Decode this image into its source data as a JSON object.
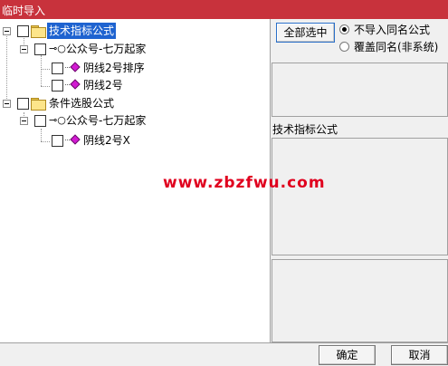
{
  "window": {
    "title": "临时导入"
  },
  "tree": {
    "nodes": [
      {
        "label": "技术指标公式"
      },
      {
        "label": "公众号-七万起家"
      },
      {
        "label": "阴线2号排序"
      },
      {
        "label": "阴线2号"
      },
      {
        "label": "条件选股公式"
      },
      {
        "label": "公众号-七万起家"
      },
      {
        "label": "阴线2号X"
      }
    ]
  },
  "options": {
    "select_all_label": "全部选中",
    "radio_no_import": "不导入同名公式",
    "radio_overwrite": "覆盖同名(非系统)"
  },
  "detail": {
    "title": "技术指标公式"
  },
  "watermark": "www.zbzfwu.com",
  "buttons": {
    "ok": "确定",
    "cancel": "取消"
  },
  "colors": {
    "titlebar": "#c8323c",
    "selection": "#1e63d0",
    "watermark": "#e0001e",
    "formula_diamond": "#d21ad2"
  }
}
